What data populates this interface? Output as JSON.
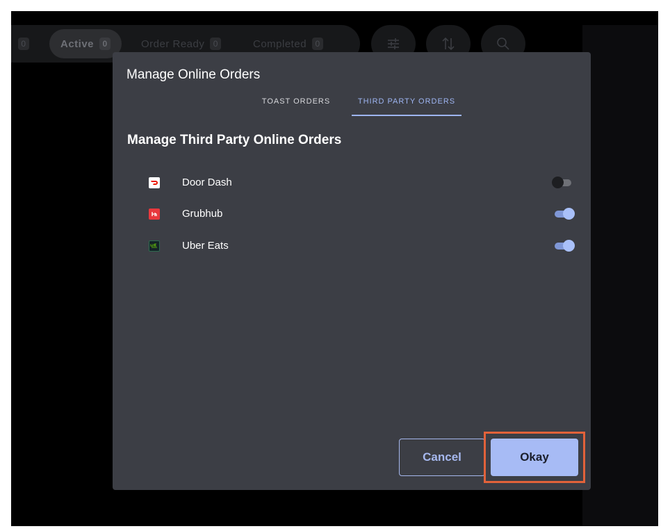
{
  "topbar": {
    "leading_count": "0",
    "chips": [
      {
        "label": "Active",
        "count": "0"
      },
      {
        "label": "Order Ready",
        "count": "0"
      },
      {
        "label": "Completed",
        "count": "0"
      }
    ],
    "icons": [
      "filter-sliders-icon",
      "sort-arrows-icon",
      "search-icon"
    ]
  },
  "modal": {
    "title": "Manage Online Orders",
    "tabs": [
      {
        "label": "TOAST ORDERS",
        "selected": false
      },
      {
        "label": "THIRD PARTY ORDERS",
        "selected": true
      }
    ],
    "section_title": "Manage Third Party Online Orders",
    "providers": [
      {
        "name": "Door Dash",
        "icon": "doordash-logo-icon",
        "enabled": false,
        "color": "#eb1700"
      },
      {
        "name": "Grubhub",
        "icon": "grubhub-logo-icon",
        "enabled": true,
        "color": "#e8383d"
      },
      {
        "name": "Uber Eats",
        "icon": "ubereats-logo-icon",
        "enabled": true,
        "color": "#142328"
      }
    ],
    "cancel_label": "Cancel",
    "okay_label": "Okay"
  },
  "colors": {
    "accent": "#a7bbf5",
    "modal_bg": "#3c3e45",
    "highlight": "#e2623a"
  }
}
